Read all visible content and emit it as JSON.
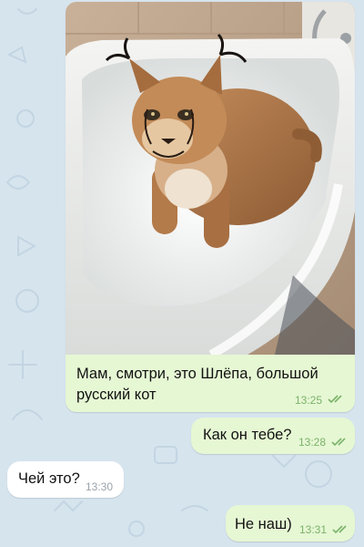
{
  "messages": [
    {
      "direction": "outgoing",
      "has_photo": true,
      "text": "Мам, смотри, это Шлёпа, большой русский кот",
      "time": "13:25",
      "status": "read"
    },
    {
      "direction": "outgoing",
      "text": "Как он тебе?",
      "time": "13:28",
      "status": "read"
    },
    {
      "direction": "incoming",
      "text": "Чей это?",
      "time": "13:30"
    },
    {
      "direction": "outgoing",
      "text": "Не наш)",
      "time": "13:31",
      "status": "read"
    }
  ],
  "colors": {
    "chat_background": "#d6e4ee",
    "outgoing_bubble": "#e6f7d4",
    "incoming_bubble": "#ffffff",
    "read_ticks": "#7bb36a"
  },
  "photo": {
    "subject": "caracal sitting in a white bathtub",
    "icon": "photo-attachment"
  }
}
